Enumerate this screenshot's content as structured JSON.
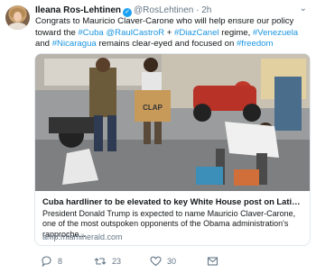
{
  "tweet": {
    "author": {
      "name": "Ileana Ros-Lehtinen",
      "handle": "@RosLehtinen",
      "separator": "·",
      "time": "2h"
    },
    "text": {
      "part1": "Congrats to Mauricio Claver-Carone who will help ensure our policy toward the ",
      "hashtag_cuba": "#Cuba",
      "space1": " ",
      "mention_raul": "@RaulCastroR",
      "part2": " + ",
      "hashtag_diazcanel": "#DiazCanel",
      "part3": " regime, ",
      "hashtag_venezuela": "#Venezuela",
      "part4": " and ",
      "hashtag_nicaragua": "#Nicaragua",
      "part5": " remains clear-eyed and focused on ",
      "hashtag_freedom": "#freedom"
    },
    "card": {
      "box_label": "CLAP",
      "title": "Cuba hardliner to be elevated to key White House post on Latin Amer...",
      "description": "President Donald Trump is expected to name Mauricio Claver-Carone, one of the most outspoken opponents of the Obama administration's rapproche...",
      "domain": "amp.miamiherald.com"
    },
    "actions": {
      "replies": "8",
      "retweets": "23",
      "likes": "30"
    },
    "colors": {
      "link": "#1b95e0",
      "verified": "#1da1f2",
      "secondary": "#657786"
    }
  }
}
